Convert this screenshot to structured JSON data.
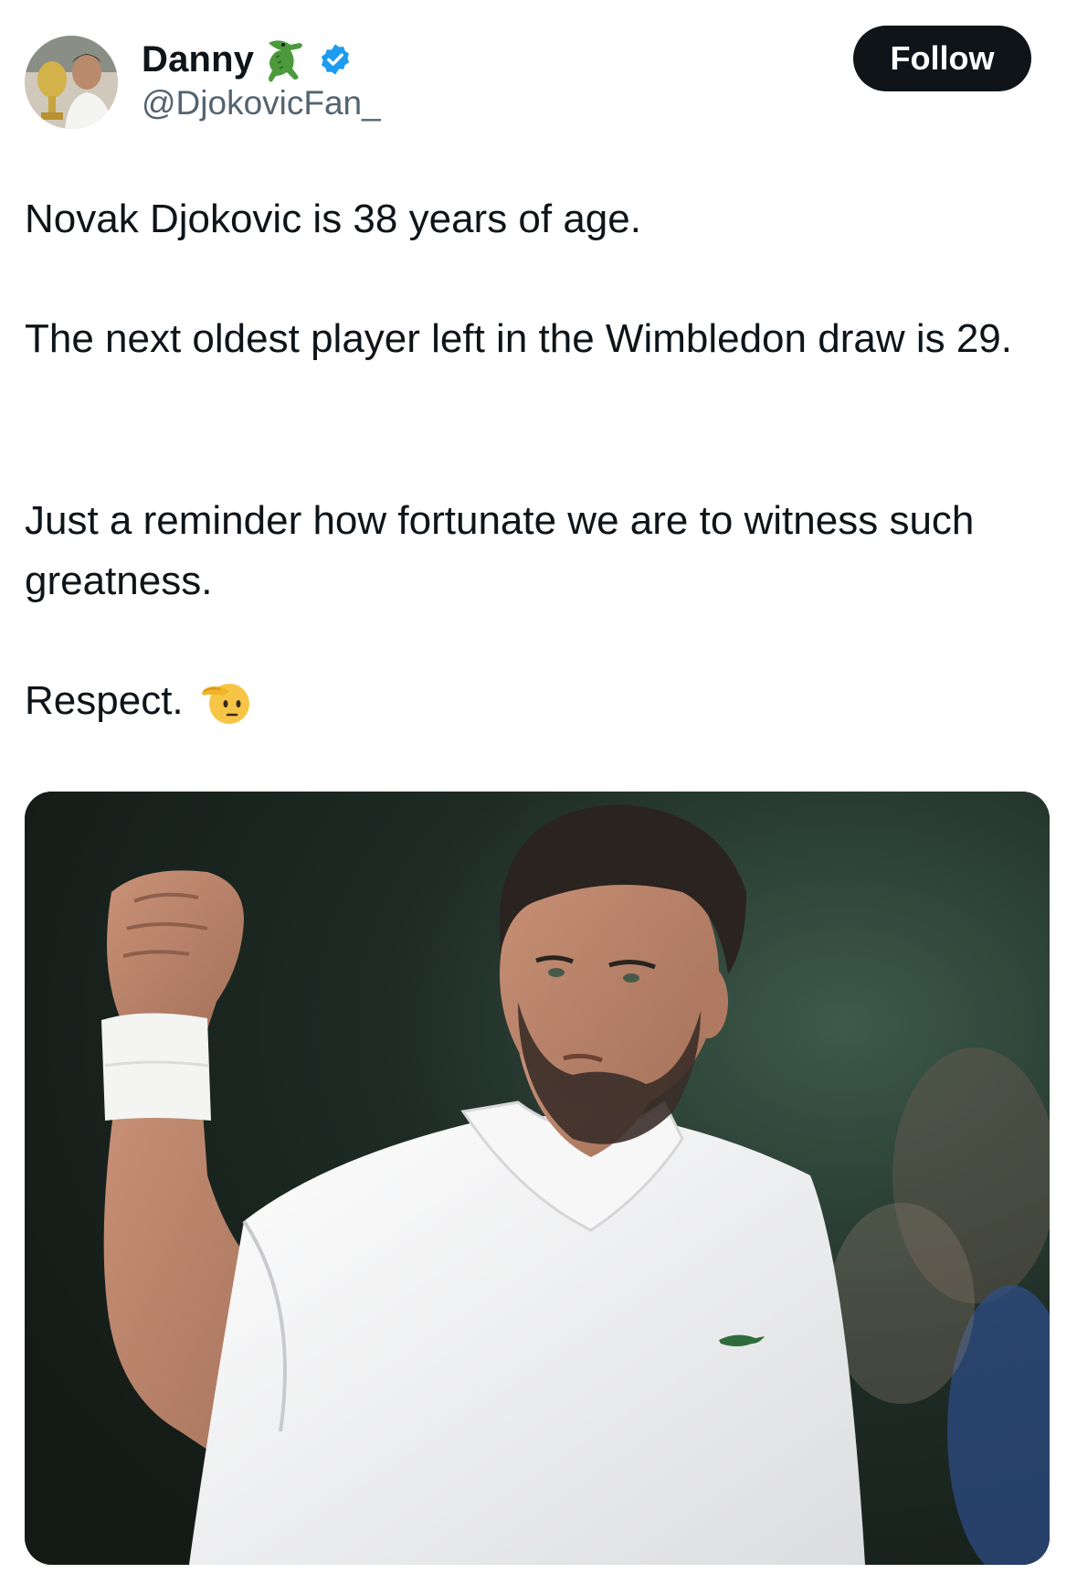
{
  "author": {
    "display_name": "Danny",
    "handle": "@DjokovicFan_",
    "name_emoji": "crocodile-emoji",
    "verified": true,
    "verified_color": "#1d9bf0"
  },
  "follow_button": {
    "label": "Follow",
    "background": "#0f1419",
    "text_color": "#ffffff"
  },
  "tweet": {
    "paragraphs": [
      "Novak Djokovic is 38 years of age.",
      "The next oldest player left in the Wimbledon draw is 29.",
      "Just a reminder how fortunate we are to witness such greatness.",
      "Respect."
    ],
    "trailing_emoji": "saluting-face-emoji"
  },
  "media": {
    "kind": "photo",
    "subject_icon": "tennis-player-fist-pump-photo"
  },
  "colors": {
    "text_primary": "#0f1419",
    "text_secondary": "#536471"
  }
}
